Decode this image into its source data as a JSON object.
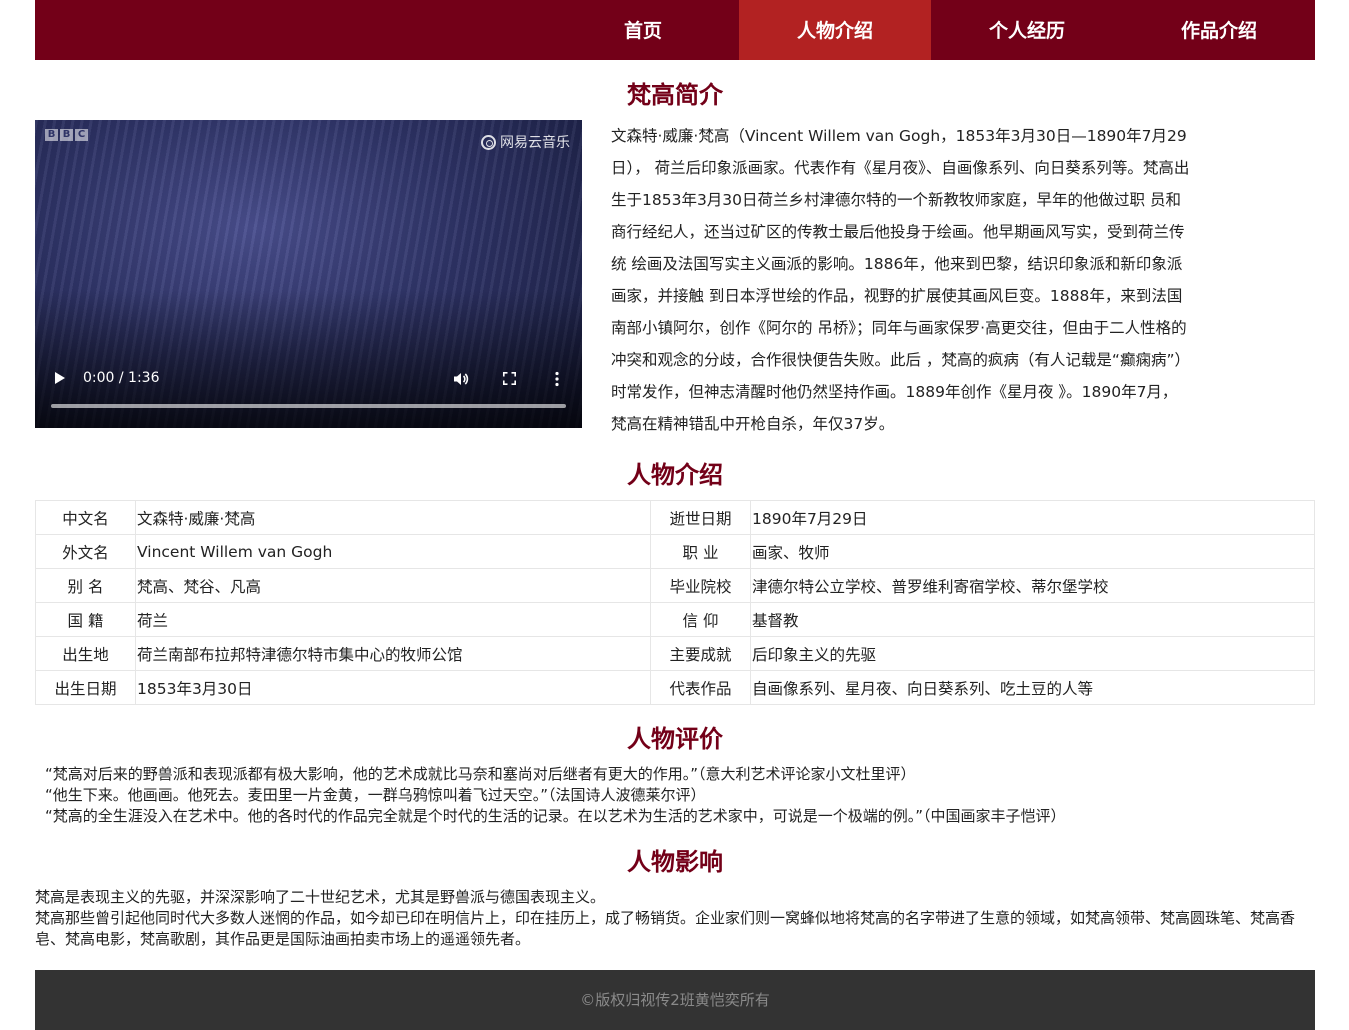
{
  "nav": {
    "items": [
      {
        "label": "首页"
      },
      {
        "label": "人物介绍"
      },
      {
        "label": "个人经历"
      },
      {
        "label": "作品介绍"
      }
    ],
    "active_index": 1
  },
  "intro": {
    "title": "梵高简介",
    "text": "文森特·威廉·梵高（Vincent Willem van Gogh，1853年3月30日—1890年7月29日）， 荷兰后印象派画家。代表作有《星月夜》、自画像系列、向日葵系列等。梵高出生于1853年3月30日荷兰乡村津德尔特的一个新教牧师家庭，早年的他做过职 员和商行经纪人，还当过矿区的传教士最后他投身于绘画。他早期画风写实，受到荷兰传统 绘画及法国写实主义画派的影响。1886年，他来到巴黎，结识印象派和新印象派画家，并接触 到日本浮世绘的作品，视野的扩展使其画风巨变。1888年，来到法国南部小镇阿尔，创作《阿尔的 吊桥》；同年与画家保罗·高更交往，但由于二人性格的冲突和观念的分歧，合作很快便告失败。此后 ，梵高的疯病（有人记载是“癫痫病”）时常发作，但神志清醒时他仍然坚持作画。1889年创作《星月夜 》。1890年7月，梵高在精神错乱中开枪自杀，年仅37岁。"
  },
  "video": {
    "time": "0:00 / 1:36",
    "watermark": "网易云音乐",
    "badge": [
      "B",
      "B",
      "C"
    ],
    "progress": 0
  },
  "profile": {
    "title": "人物介绍",
    "rows": [
      {
        "k1": "中文名",
        "v1": "文森特·威廉·梵高",
        "k2": "逝世日期",
        "v2": "1890年7月29日"
      },
      {
        "k1": "外文名",
        "v1": "Vincent Willem van Gogh",
        "k2": "职 业",
        "v2": "画家、牧师"
      },
      {
        "k1": "别 名",
        "v1": "梵高、梵谷、凡高",
        "k2": "毕业院校",
        "v2": "津德尔特公立学校、普罗维利寄宿学校、蒂尔堡学校"
      },
      {
        "k1": "国 籍",
        "v1": "荷兰",
        "k2": "信 仰",
        "v2": "基督教"
      },
      {
        "k1": "出生地",
        "v1": "荷兰南部布拉邦特津德尔特市集中心的牧师公馆",
        "k2": "主要成就",
        "v2": "后印象主义的先驱"
      },
      {
        "k1": "出生日期",
        "v1": "1853年3月30日",
        "k2": "代表作品",
        "v2": "自画像系列、星月夜、向日葵系列、吃土豆的人等"
      }
    ]
  },
  "reviews": {
    "title": "人物评价",
    "items": [
      "“梵高对后来的野兽派和表现派都有极大影响，他的艺术成就比马奈和塞尚对后继者有更大的作用。”（意大利艺术评论家小文杜里评）",
      "“他生下来。他画画。他死去。麦田里一片金黄，一群乌鸦惊叫着飞过天空。”（法国诗人波德莱尔评）",
      "“梵高的全生涯没入在艺术中。他的各时代的作品完全就是个时代的生活的记录。在以艺术为生活的艺术家中，可说是一个极端的例。”（中国画家丰子恺评）"
    ]
  },
  "influence": {
    "title": "人物影响",
    "paragraphs": [
      "梵高是表现主义的先驱，并深深影响了二十世纪艺术，尤其是野兽派与德国表现主义。",
      "梵高那些曾引起他同时代大多数人迷惘的作品，如今却已印在明信片上，印在挂历上，成了畅销货。企业家们则一窝蜂似地将梵高的名字带进了生意的领域，如梵高领带、梵高圆珠笔、梵高香皂、梵高电影，梵高歌剧，其作品更是国际油画拍卖市场上的遥遥领先者。"
    ]
  },
  "footer": {
    "text": "©版权归视传2班黄恺奕所有"
  },
  "colors": {
    "nav_bg": "#730018",
    "nav_active": "#b22222",
    "heading": "#730018",
    "footer_bg": "#333333"
  }
}
